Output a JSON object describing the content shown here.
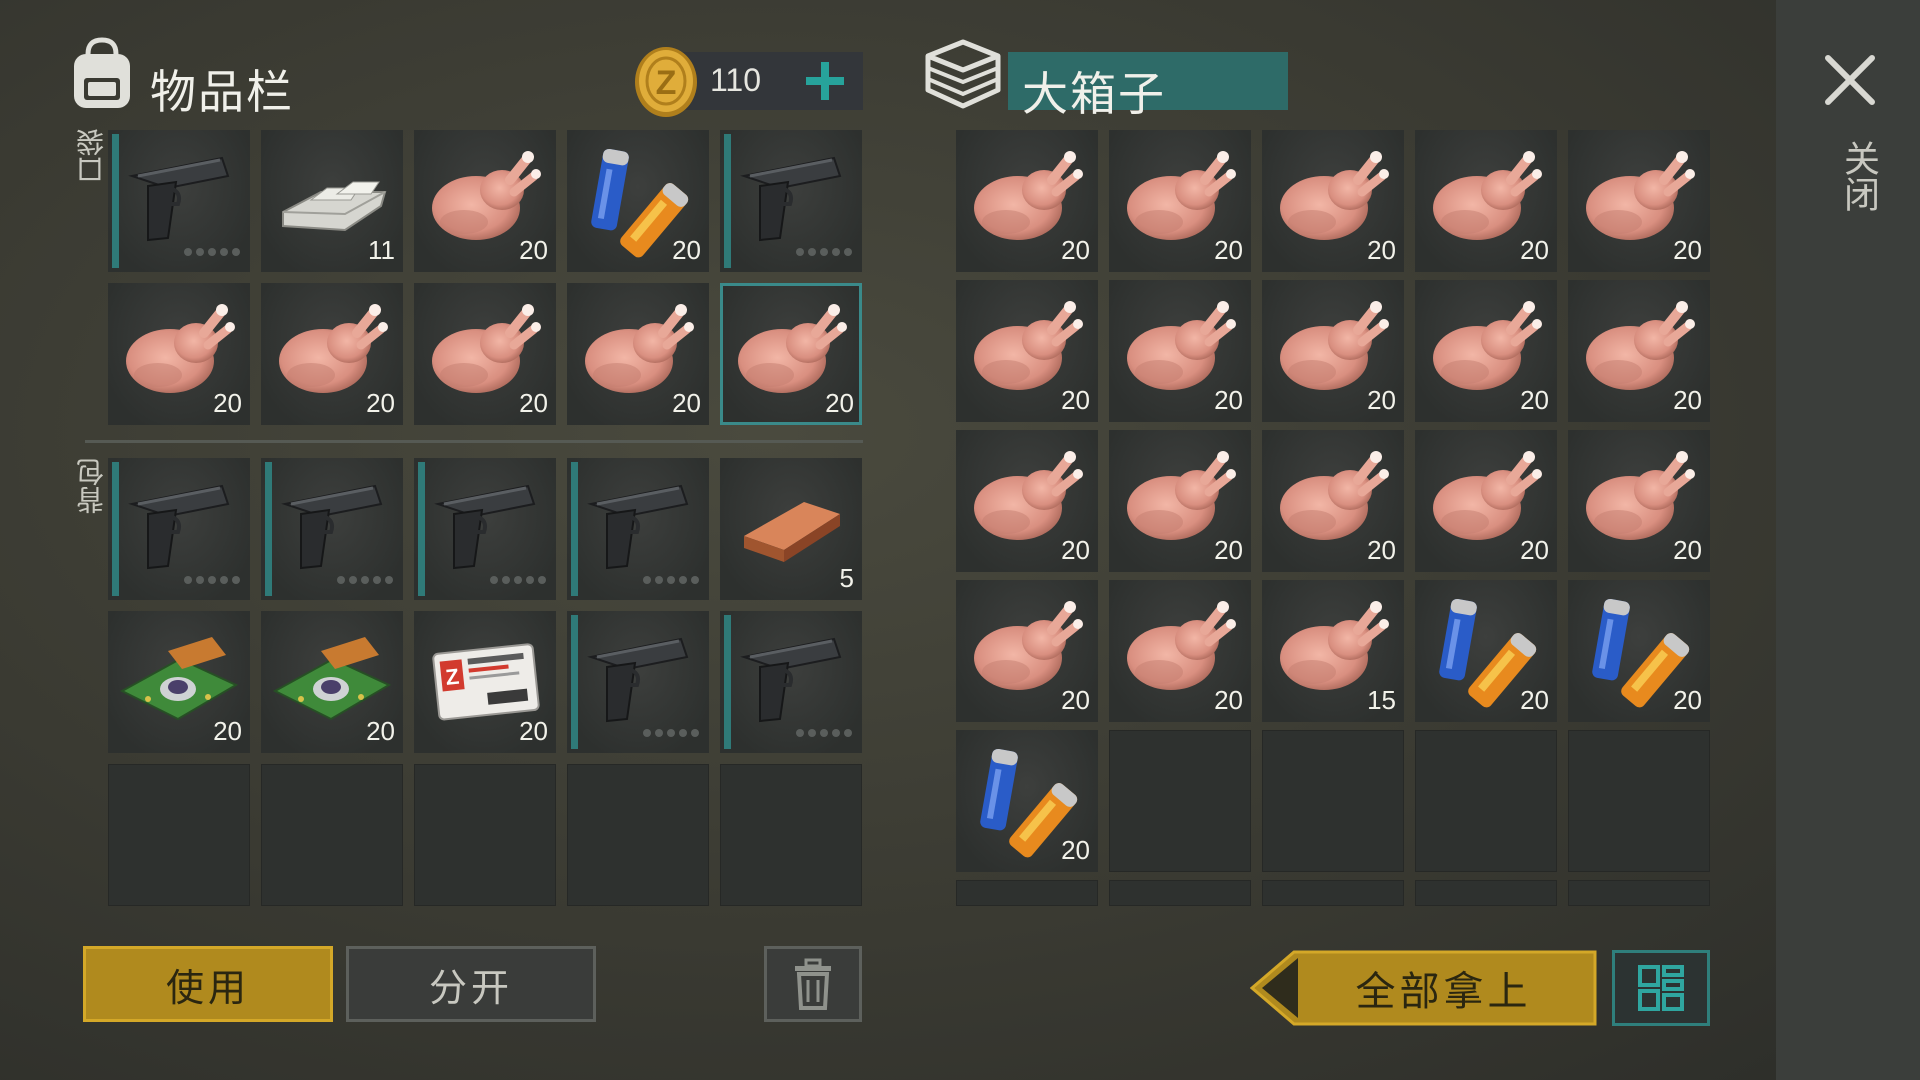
{
  "inventory": {
    "title": "物品栏",
    "coins": "110",
    "pocket_label": "口袋",
    "backpack_label": "背包",
    "pocket_items": [
      {
        "type": "pistol",
        "count": ""
      },
      {
        "type": "ingot-silver",
        "count": "11"
      },
      {
        "type": "chicken",
        "count": "20"
      },
      {
        "type": "battery",
        "count": "20"
      },
      {
        "type": "pistol",
        "count": ""
      },
      {
        "type": "chicken",
        "count": "20"
      },
      {
        "type": "chicken",
        "count": "20"
      },
      {
        "type": "chicken",
        "count": "20"
      },
      {
        "type": "chicken",
        "count": "20"
      },
      {
        "type": "chicken",
        "count": "20",
        "selected": true
      }
    ],
    "backpack_items": [
      {
        "type": "pistol",
        "count": ""
      },
      {
        "type": "pistol",
        "count": ""
      },
      {
        "type": "pistol",
        "count": ""
      },
      {
        "type": "pistol",
        "count": ""
      },
      {
        "type": "ingot-copper",
        "count": "5"
      },
      {
        "type": "circuit",
        "count": "20"
      },
      {
        "type": "circuit",
        "count": "20"
      },
      {
        "type": "id-card",
        "count": "20"
      },
      {
        "type": "pistol",
        "count": ""
      },
      {
        "type": "pistol",
        "count": ""
      },
      {
        "type": "empty",
        "count": ""
      },
      {
        "type": "empty",
        "count": ""
      },
      {
        "type": "empty",
        "count": ""
      },
      {
        "type": "empty",
        "count": ""
      },
      {
        "type": "empty",
        "count": ""
      }
    ],
    "use_label": "使用",
    "split_label": "分开"
  },
  "container": {
    "title": "大箱子",
    "items": [
      {
        "type": "chicken",
        "count": "20"
      },
      {
        "type": "chicken",
        "count": "20"
      },
      {
        "type": "chicken",
        "count": "20"
      },
      {
        "type": "chicken",
        "count": "20"
      },
      {
        "type": "chicken",
        "count": "20"
      },
      {
        "type": "chicken",
        "count": "20"
      },
      {
        "type": "chicken",
        "count": "20"
      },
      {
        "type": "chicken",
        "count": "20"
      },
      {
        "type": "chicken",
        "count": "20"
      },
      {
        "type": "chicken",
        "count": "20"
      },
      {
        "type": "chicken",
        "count": "20"
      },
      {
        "type": "chicken",
        "count": "20"
      },
      {
        "type": "chicken",
        "count": "20"
      },
      {
        "type": "chicken",
        "count": "20"
      },
      {
        "type": "chicken",
        "count": "20"
      },
      {
        "type": "chicken",
        "count": "20"
      },
      {
        "type": "chicken",
        "count": "20"
      },
      {
        "type": "chicken",
        "count": "15"
      },
      {
        "type": "battery",
        "count": "20"
      },
      {
        "type": "battery",
        "count": "20"
      },
      {
        "type": "battery",
        "count": "20"
      },
      {
        "type": "empty",
        "count": ""
      },
      {
        "type": "empty",
        "count": ""
      },
      {
        "type": "empty",
        "count": ""
      },
      {
        "type": "empty",
        "count": ""
      }
    ],
    "take_all_label": "全部拿上"
  },
  "close_label": "关闭",
  "colors": {
    "accent": "#2f7a78",
    "gold": "#b08a1e"
  }
}
